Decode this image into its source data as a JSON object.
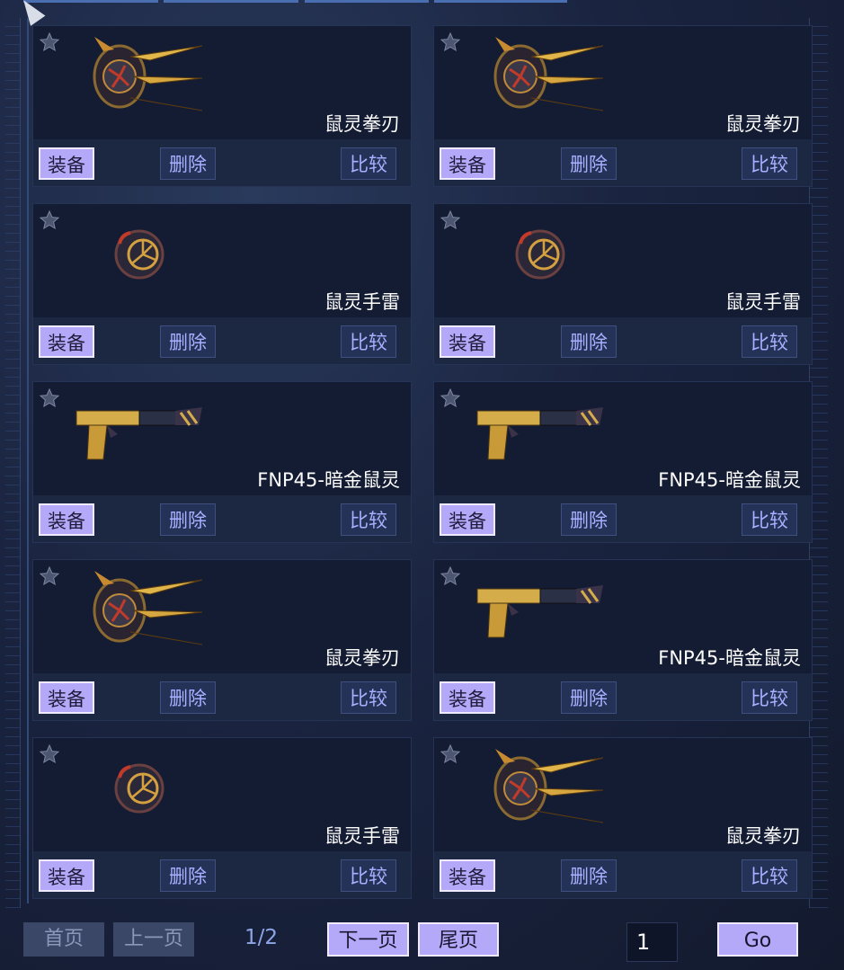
{
  "items": [
    {
      "name": "鼠灵拳刃",
      "icon": "knuckle-blade-icon"
    },
    {
      "name": "鼠灵拳刃",
      "icon": "knuckle-blade-icon"
    },
    {
      "name": "鼠灵手雷",
      "icon": "grenade-icon"
    },
    {
      "name": "鼠灵手雷",
      "icon": "grenade-icon"
    },
    {
      "name": "FNP45-暗金鼠灵",
      "icon": "pistol-icon"
    },
    {
      "name": "FNP45-暗金鼠灵",
      "icon": "pistol-icon"
    },
    {
      "name": "鼠灵拳刃",
      "icon": "knuckle-blade-icon"
    },
    {
      "name": "FNP45-暗金鼠灵",
      "icon": "pistol-icon"
    },
    {
      "name": "鼠灵手雷",
      "icon": "grenade-icon"
    },
    {
      "name": "鼠灵拳刃",
      "icon": "knuckle-blade-icon"
    }
  ],
  "buttons": {
    "equip": "装备",
    "delete": "删除",
    "compare": "比较"
  },
  "pager": {
    "first": "首页",
    "prev": "上一页",
    "indicator": "1/2",
    "next": "下一页",
    "last": "尾页",
    "input_value": "1",
    "go": "Go"
  },
  "colors": {
    "accent": "#b4a9f8",
    "secondary_button": "#253258",
    "card": "#141c33",
    "background": "#1a2440"
  }
}
